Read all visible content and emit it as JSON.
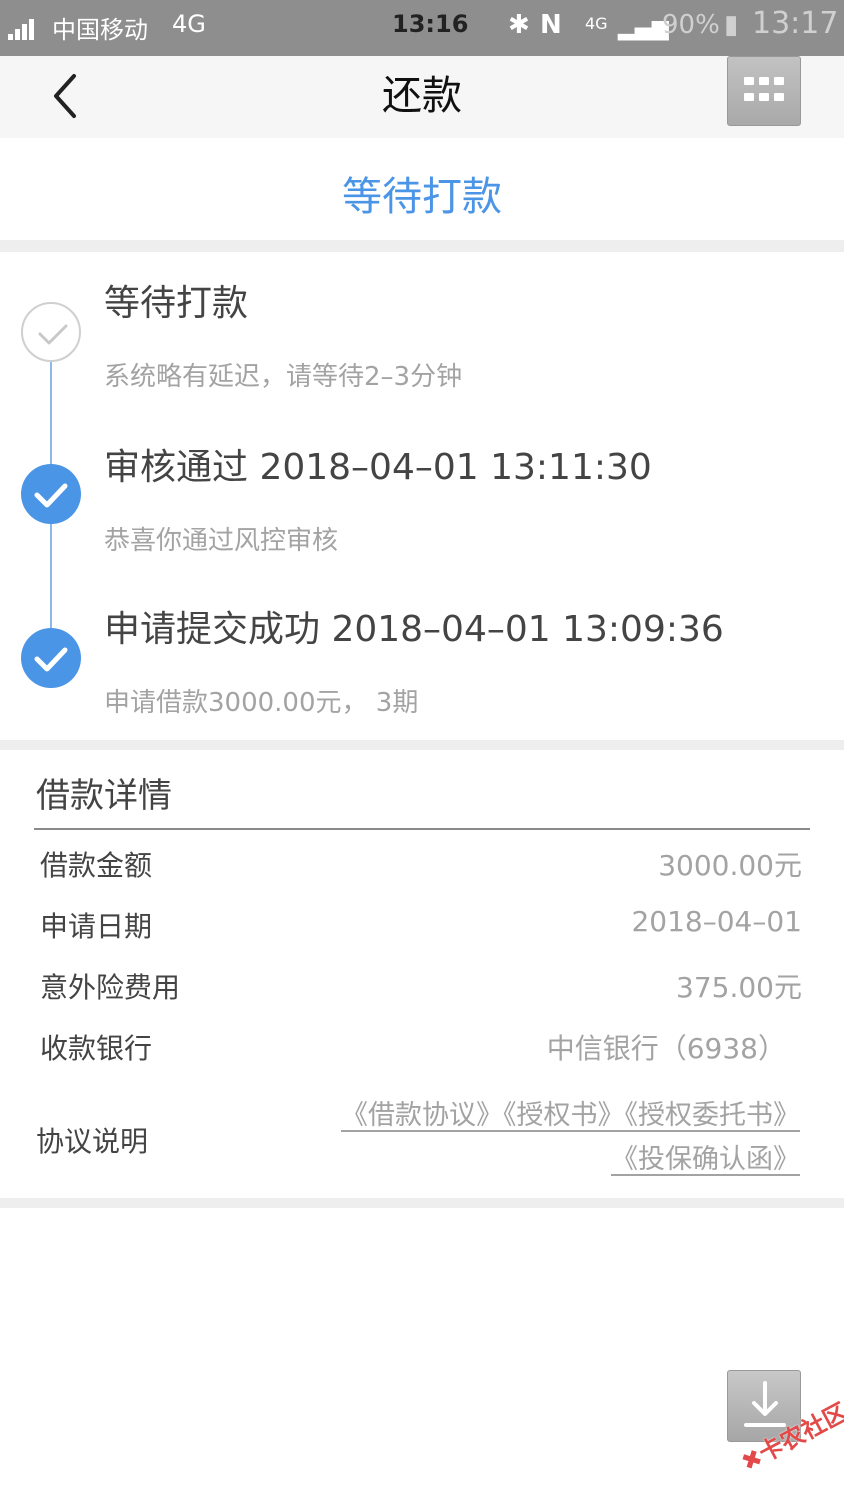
{
  "status_bar": {
    "carrier": "中国移动",
    "network": "4G",
    "time": "13:16",
    "battery_percent": "90%",
    "overlay_time": "13:17"
  },
  "navbar": {
    "title": "还款"
  },
  "status_banner": {
    "text": "等待打款"
  },
  "timeline": {
    "steps": [
      {
        "title": "等待打款",
        "desc": "系统略有延迟，请等待2–3分钟",
        "done": false
      },
      {
        "title": "审核通过 2018–04–01 13:11:30",
        "desc": "恭喜你通过风控审核",
        "done": true
      },
      {
        "title": "申请提交成功 2018–04–01 13:09:36",
        "desc": "申请借款3000.00元，  3期",
        "done": true
      }
    ]
  },
  "details": {
    "title": "借款详情",
    "rows": [
      {
        "label": "借款金额",
        "value": "3000.00元"
      },
      {
        "label": "申请日期",
        "value": "2018–04–01"
      },
      {
        "label": "意外险费用",
        "value": "375.00元"
      },
      {
        "label": "收款银行",
        "value": "中信银行（6938）"
      }
    ],
    "agreement_label": "协议说明",
    "agreements": [
      "《借款协议》",
      "《授权书》",
      "《授权委托书》",
      "《投保确认函》"
    ]
  },
  "watermark": {
    "text": "卡农社区"
  },
  "colors": {
    "accent": "#4b95e6",
    "muted_text": "#a3a3a3",
    "status_bar_bg": "#8e8e8e"
  }
}
